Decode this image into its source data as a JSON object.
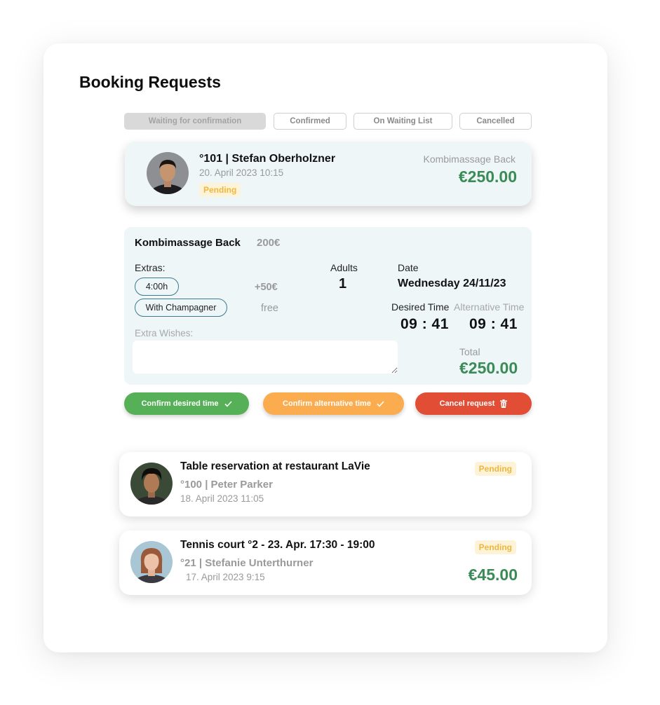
{
  "page": {
    "title": "Booking Requests"
  },
  "tabs": [
    {
      "label": "Waiting for confirmation",
      "active": true
    },
    {
      "label": "Confirmed",
      "active": false
    },
    {
      "label": "On Waiting List",
      "active": false
    },
    {
      "label": "Cancelled",
      "active": false
    }
  ],
  "selected_request": {
    "guest": "°101 | Stefan Oberholzner",
    "datetime": "20. April 2023 10:15",
    "status": "Pending",
    "service": "Kombimassage Back",
    "price": "€250.00"
  },
  "detail": {
    "title": "Kombimassage Back",
    "base_price": "200€",
    "extras_label": "Extras:",
    "extras": [
      {
        "label": "4:00h",
        "price": "+50€"
      },
      {
        "label": "With Champagner",
        "price": "free"
      }
    ],
    "wishes_label": "Extra Wishes:",
    "wishes_value": "",
    "adults_label": "Adults",
    "adults": "1",
    "date_label": "Date",
    "date": "Wednesday 24/11/23",
    "desired_time_label": "Desired Time",
    "desired_time": "09 : 41",
    "alternative_time_label": "Alternative Time",
    "alternative_time": "09 : 41",
    "total_label": "Total",
    "total": "€250.00"
  },
  "actions": {
    "confirm_desired": "Confirm desired time",
    "confirm_alternative": "Confirm alternative time",
    "cancel": "Cancel request"
  },
  "requests": [
    {
      "title": "Table reservation at restaurant LaVie",
      "guest": "°100 | Peter Parker",
      "datetime": "18. April 2023 11:05",
      "status": "Pending",
      "price": ""
    },
    {
      "title": "Tennis court °2 - 23. Apr. 17:30 - 19:00",
      "guest": "°21 | Stefanie Unterthurner",
      "datetime": "17. April 2023 9:15",
      "status": "Pending",
      "price": "€45.00"
    }
  ],
  "colors": {
    "price_green": "#3b8b57",
    "pending_bg": "#fdf3d9",
    "pending_text": "#f0b73c",
    "confirm_green": "#55b057",
    "confirm_orange": "#fbac4f",
    "cancel_red": "#e14d35",
    "card_tint": "#eef6f8"
  },
  "icons": [
    "checkmark-icon",
    "trash-icon",
    "avatar-stefan",
    "avatar-peter",
    "avatar-stefanie"
  ]
}
